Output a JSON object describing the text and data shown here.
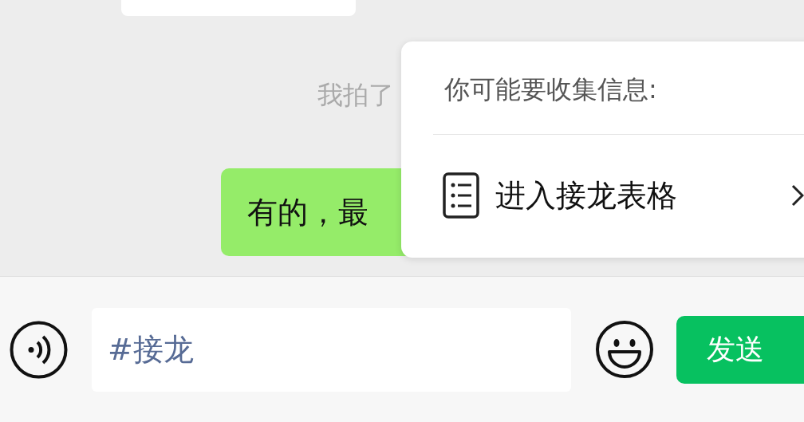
{
  "messages": [
    {
      "kind": "incoming"
    },
    {
      "kind": "system",
      "text": "我拍了"
    },
    {
      "kind": "outgoing",
      "text": "有的，最"
    }
  ],
  "popup": {
    "title": "你可能要收集信息:",
    "items": [
      {
        "label": "进入接龙表格"
      }
    ]
  },
  "input": {
    "value": "#接龙"
  },
  "send_button": {
    "label": "发送"
  }
}
